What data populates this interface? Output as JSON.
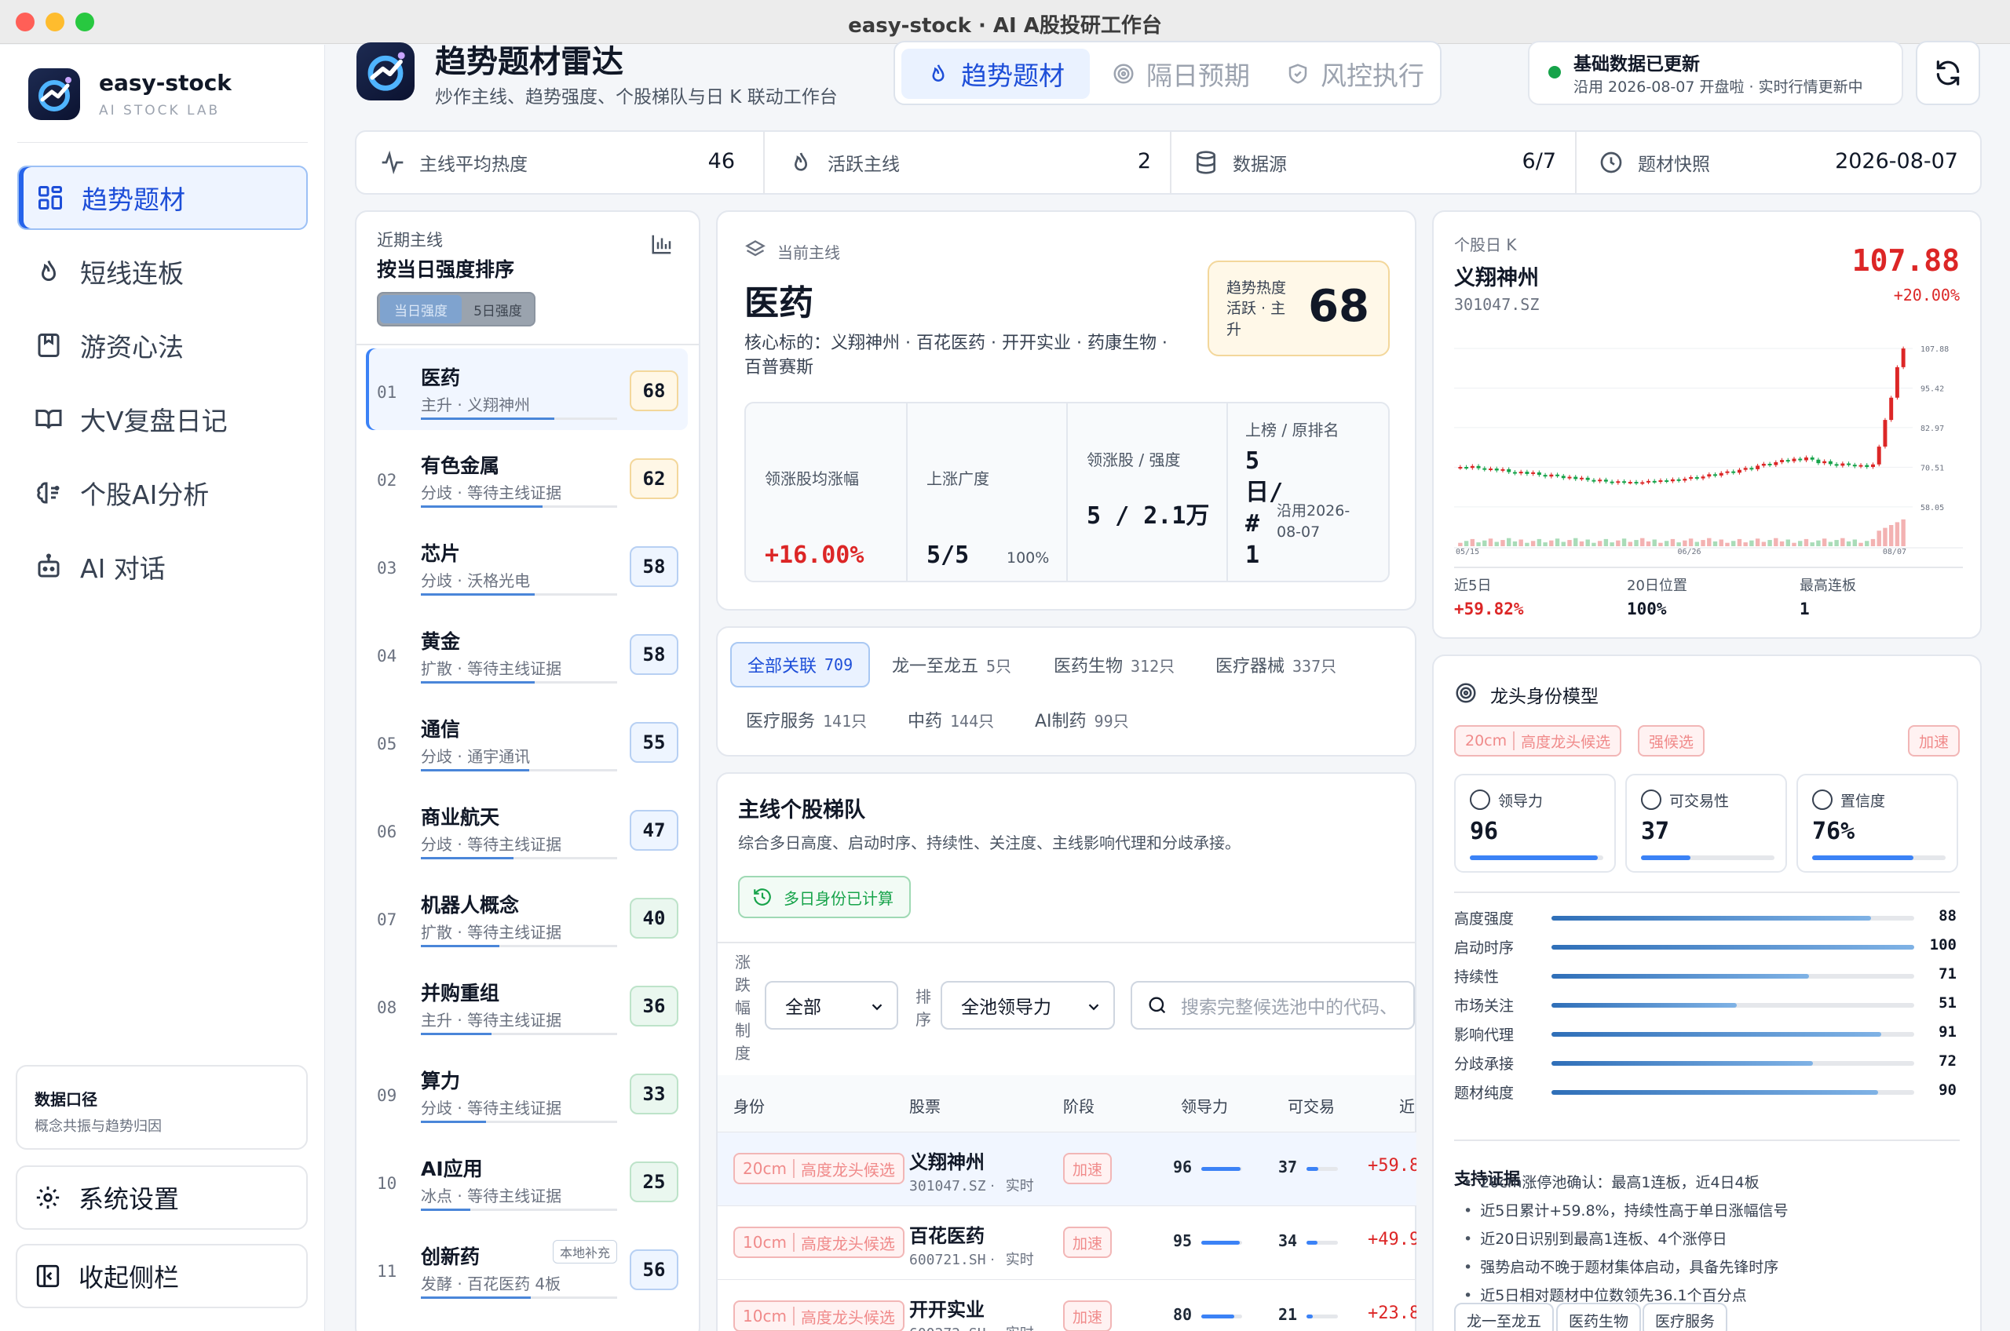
{
  "window": {
    "title": "easy-stock · AI A股投研工作台"
  },
  "sidebar": {
    "brand": "easy-stock",
    "brand_sub": "AI STOCK LAB",
    "items": [
      {
        "label": "趋势题材",
        "icon": "grid-icon"
      },
      {
        "label": "短线连板",
        "icon": "flame-icon"
      },
      {
        "label": "游资心法",
        "icon": "bookmark-icon"
      },
      {
        "label": "大V复盘日记",
        "icon": "book-icon"
      },
      {
        "label": "个股AI分析",
        "icon": "brain-icon"
      },
      {
        "label": "AI 对话",
        "icon": "robot-icon"
      }
    ],
    "data_card": {
      "title": "数据口径",
      "sub": "概念共振与趋势归因"
    },
    "settings": "系统设置",
    "collapse": "收起侧栏"
  },
  "header": {
    "title": "趋势题材雷达",
    "subtitle": "炒作主线、趋势强度、个股梯队与日 K 联动工作台",
    "tabs": [
      "趋势题材",
      "隔日预期",
      "风控执行"
    ],
    "status_title": "基础数据已更新",
    "status_sub": "沿用 2026-08-07 开盘啦 · 实时行情更新中"
  },
  "stats": [
    {
      "label": "主线平均热度",
      "value": "46"
    },
    {
      "label": "活跃主线",
      "value": "2"
    },
    {
      "label": "数据源",
      "value": "6/7"
    },
    {
      "label": "题材快照",
      "value": "2026-08-07"
    }
  ],
  "themes": {
    "label": "近期主线",
    "title": "按当日强度排序",
    "toggle": [
      "当日强度",
      "5日强度"
    ],
    "items": [
      {
        "rank": "01",
        "name": "医药",
        "sub": "主升 · 义翔神州",
        "score": "68",
        "pct": 0.68,
        "style": "y"
      },
      {
        "rank": "02",
        "name": "有色金属",
        "sub": "分歧 · 等待主线证据",
        "score": "62",
        "pct": 0.62,
        "style": "y"
      },
      {
        "rank": "03",
        "name": "芯片",
        "sub": "分歧 · 沃格光电",
        "score": "58",
        "pct": 0.58,
        "style": "b"
      },
      {
        "rank": "04",
        "name": "黄金",
        "sub": "扩散 · 等待主线证据",
        "score": "58",
        "pct": 0.58,
        "style": "b"
      },
      {
        "rank": "05",
        "name": "通信",
        "sub": "分歧 · 通宇通讯",
        "score": "55",
        "pct": 0.55,
        "style": "b"
      },
      {
        "rank": "06",
        "name": "商业航天",
        "sub": "分歧 · 等待主线证据",
        "score": "47",
        "pct": 0.47,
        "style": "b"
      },
      {
        "rank": "07",
        "name": "机器人概念",
        "sub": "扩散 · 等待主线证据",
        "score": "40",
        "pct": 0.4,
        "style": "g"
      },
      {
        "rank": "08",
        "name": "并购重组",
        "sub": "主升 · 等待主线证据",
        "score": "36",
        "pct": 0.36,
        "style": "g"
      },
      {
        "rank": "09",
        "name": "算力",
        "sub": "分歧 · 等待主线证据",
        "score": "33",
        "pct": 0.33,
        "style": "g"
      },
      {
        "rank": "10",
        "name": "AI应用",
        "sub": "冰点 · 等待主线证据",
        "score": "25",
        "pct": 0.25,
        "style": "g"
      },
      {
        "rank": "11",
        "name": "创新药",
        "sub": "发酵 · 百花医药 4板",
        "score": "56",
        "pct": 0.56,
        "style": "b",
        "tag": "本地补充"
      }
    ]
  },
  "current": {
    "label": "当前主线",
    "name": "医药",
    "core": "核心标的：义翔神州 · 百花医药 · 开开实业 · 药康生物 · 百普赛斯",
    "heat_label": "趋势热度",
    "heat_sub": "活跃 · 主升",
    "heat_value": "68",
    "metrics": [
      {
        "label": "领涨股均涨幅",
        "value": "+16.00%"
      },
      {
        "label": "上涨广度",
        "value": "5/5",
        "extra": "100%"
      },
      {
        "label": "领涨股 / 强度",
        "value": "5 / 2.1万"
      },
      {
        "label": "上榜 / 原排名",
        "value": "5日/#1",
        "extra": "沿用2026-08-07"
      }
    ]
  },
  "filters": [
    {
      "label": "全部关联",
      "count": "709"
    },
    {
      "label": "龙一至龙五",
      "count": "5只"
    },
    {
      "label": "医药生物",
      "count": "312只"
    },
    {
      "label": "医疗器械",
      "count": "337只"
    },
    {
      "label": "医疗服务",
      "count": "141只"
    },
    {
      "label": "中药",
      "count": "144只"
    },
    {
      "label": "AI制药",
      "count": "99只"
    }
  ],
  "ladder": {
    "title": "主线个股梯队",
    "desc": "综合多日高度、启动时序、持续性、关注度、主线影响代理和分歧承接。",
    "badge": "多日身份已计算",
    "limit_label": "涨跌幅制度",
    "limit_value": "全部",
    "sort_label": "排序",
    "sort_value": "全池领导力",
    "search_placeholder": "搜索完整候选池中的代码、",
    "columns": [
      "身份",
      "股票",
      "阶段",
      "领导力",
      "可交易",
      "近"
    ],
    "rows": [
      {
        "tag_a": "20cm",
        "tag_b": "高度龙头候选",
        "name": "义翔神州",
        "code": "301047.SZ",
        "rt": "实时",
        "stage": "加速",
        "lead": "96",
        "trade": "37",
        "gain": "+59.8"
      },
      {
        "tag_a": "10cm",
        "tag_b": "高度龙头候选",
        "name": "百花医药",
        "code": "600721.SH",
        "rt": "实时",
        "stage": "加速",
        "lead": "95",
        "trade": "34",
        "gain": "+49.9"
      },
      {
        "tag_a": "10cm",
        "tag_b": "高度龙头候选",
        "name": "开开实业",
        "code": "600272.SH",
        "rt": "实时",
        "stage": "加速",
        "lead": "80",
        "trade": "21",
        "gain": "+23.8"
      }
    ]
  },
  "stock": {
    "label": "个股日 K",
    "name": "义翔神州",
    "code": "301047.SZ",
    "price": "107.88",
    "change": "+20.00%",
    "axis": [
      "107.88",
      "95.42",
      "82.97",
      "70.51",
      "58.05"
    ],
    "dates": [
      "05/15",
      "06/26",
      "08/07"
    ],
    "kpis": [
      {
        "label": "近5日",
        "value": "+59.82%"
      },
      {
        "label": "20日位置",
        "value": "100%"
      },
      {
        "label": "最高连板",
        "value": "1"
      }
    ]
  },
  "chart_data": {
    "type": "candlestick",
    "title": "",
    "ylim": [
      58.05,
      107.88
    ],
    "yticks": [
      107.88,
      95.42,
      82.97,
      70.51,
      58.05
    ],
    "xticks": [
      "05/15",
      "06/26",
      "08/07"
    ],
    "close_series": [
      70.6,
      70.3,
      70.9,
      70.2,
      69.8,
      70.1,
      69.5,
      69.9,
      69.0,
      68.6,
      69.1,
      68.4,
      68.9,
      68.1,
      67.6,
      68.2,
      67.8,
      67.1,
      67.5,
      66.8,
      67.2,
      66.5,
      66.1,
      66.6,
      66.0,
      65.6,
      66.1,
      65.7,
      65.9,
      65.5,
      65.8,
      66.2,
      65.9,
      66.4,
      66.1,
      66.7,
      66.3,
      66.9,
      67.4,
      67.0,
      67.6,
      68.3,
      67.9,
      68.7,
      69.2,
      68.8,
      69.7,
      70.3,
      69.9,
      71.0,
      71.6,
      71.2,
      72.1,
      72.8,
      72.4,
      73.2,
      72.7,
      73.6,
      72.9,
      71.8,
      72.4,
      71.5,
      71.0,
      71.7,
      71.3,
      70.8,
      71.2,
      70.6,
      71.4,
      77.0,
      85.4,
      92.4,
      102.0,
      107.88
    ],
    "volume_note": "relative daily volume bars"
  },
  "identity": {
    "title": "龙头身份模型",
    "tags": [
      "20cm",
      "高度龙头候选",
      "强候选",
      "加速"
    ],
    "factors": [
      {
        "label": "领导力",
        "value": "96",
        "pct": 0.96
      },
      {
        "label": "可交易性",
        "value": "37",
        "pct": 0.37
      },
      {
        "label": "置信度",
        "value": "76%",
        "pct": 0.76
      }
    ],
    "scores": [
      {
        "label": "高度强度",
        "value": "88",
        "pct": 0.88
      },
      {
        "label": "启动时序",
        "value": "100",
        "pct": 1.0
      },
      {
        "label": "持续性",
        "value": "71",
        "pct": 0.71
      },
      {
        "label": "市场关注",
        "value": "51",
        "pct": 0.51
      },
      {
        "label": "影响代理",
        "value": "91",
        "pct": 0.91
      },
      {
        "label": "分歧承接",
        "value": "72",
        "pct": 0.72
      },
      {
        "label": "题材纯度",
        "value": "90",
        "pct": 0.9
      }
    ],
    "evidence_title": "支持证据",
    "evidence": [
      "20cm涨停池确认：最高1连板，近4日4板",
      "近5日累计+59.8%，持续性高于单日涨幅信号",
      "近20日识别到最高1连板、4个涨停日",
      "强势启动不晚于题材集体启动，具备先锋时序",
      "近5日相对题材中位数领先36.1个百分点"
    ],
    "bottom_tags": [
      "龙一至龙五",
      "医药生物",
      "医疗服务"
    ]
  }
}
